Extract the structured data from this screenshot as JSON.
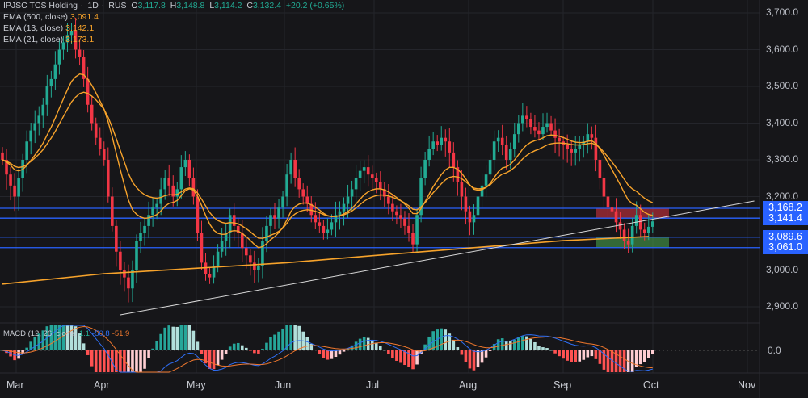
{
  "header": {
    "symbol": "IPJSC TCS Holding",
    "interval": "1D",
    "exchange": "RUS",
    "sep": "·",
    "o_label": "O",
    "o": "3,117.8",
    "h_label": "H",
    "h": "3,148.8",
    "l_label": "L",
    "l": "3,114.2",
    "c_label": "C",
    "c": "3,132.4",
    "change": "+20.2 (+0.65%)"
  },
  "indicators": [
    {
      "label": "EMA (500, close)",
      "value": "3,091.4"
    },
    {
      "label": "EMA (13, close)",
      "value": "3,142.1"
    },
    {
      "label": "EMA (21, close)",
      "value": "3,173.1"
    }
  ],
  "macd": {
    "label": "MACD (12, 26, close)",
    "hist": "1.1",
    "macd": "-50.8",
    "signal": "-51.9",
    "zero_label": "0.0"
  },
  "colors": {
    "up": "#22ab94",
    "down": "#f23645",
    "ema13": "#f7a32b",
    "ema21": "#f7a32b",
    "ema500": "#f7a32b",
    "level": "#2962ff",
    "macd": "#2f6ff5",
    "signal": "#f0782e"
  },
  "chart_data": {
    "type": "candlestick",
    "ylim": [
      2850,
      3720
    ],
    "yticks": [
      "3,700.0",
      "3,600.0",
      "3,500.0",
      "3,400.0",
      "3,300.0",
      "3,200.0",
      "3,000.0",
      "2,900.0"
    ],
    "ytick_values": [
      3700,
      3600,
      3500,
      3400,
      3300,
      3200,
      3000,
      2900
    ],
    "months": [
      "Mar",
      "Apr",
      "May",
      "Jun",
      "Jul",
      "Aug",
      "Sep",
      "Oct",
      "Nov"
    ],
    "closes": [
      3300,
      3260,
      3230,
      3200,
      3250,
      3300,
      3350,
      3380,
      3400,
      3420,
      3450,
      3500,
      3520,
      3560,
      3600,
      3620,
      3640,
      3650,
      3600,
      3580,
      3520,
      3450,
      3400,
      3360,
      3330,
      3300,
      3200,
      3120,
      3050,
      3000,
      2980,
      2950,
      3000,
      3080,
      3100,
      3120,
      3150,
      3170,
      3180,
      3220,
      3250,
      3230,
      3200,
      3220,
      3280,
      3300,
      3250,
      3200,
      3100,
      3020,
      2990,
      2980,
      3010,
      3050,
      3080,
      3100,
      3150,
      3120,
      3100,
      3060,
      3040,
      3020,
      3000,
      3010,
      3080,
      3120,
      3150,
      3140,
      3170,
      3200,
      3260,
      3300,
      3250,
      3220,
      3200,
      3180,
      3150,
      3130,
      3120,
      3100,
      3110,
      3130,
      3150,
      3160,
      3180,
      3200,
      3220,
      3250,
      3270,
      3280,
      3260,
      3250,
      3240,
      3220,
      3200,
      3180,
      3160,
      3150,
      3140,
      3120,
      3100,
      3070,
      3150,
      3250,
      3300,
      3330,
      3350,
      3340,
      3360,
      3350,
      3320,
      3280,
      3240,
      3200,
      3160,
      3130,
      3150,
      3200,
      3230,
      3260,
      3300,
      3350,
      3360,
      3340,
      3300,
      3330,
      3370,
      3400,
      3420,
      3410,
      3390,
      3380,
      3370,
      3390,
      3400,
      3380,
      3360,
      3350,
      3340,
      3330,
      3320,
      3330,
      3340,
      3350,
      3370,
      3360,
      3300,
      3250,
      3200,
      3170,
      3160,
      3130,
      3110,
      3080,
      3070,
      3120,
      3150,
      3110,
      3100,
      3117.8,
      3132.4
    ],
    "ema500_points": [
      [
        0,
        2962
      ],
      [
        25,
        2990
      ],
      [
        48,
        3005
      ],
      [
        70,
        3020
      ],
      [
        92,
        3040
      ],
      [
        115,
        3060
      ],
      [
        138,
        3080
      ],
      [
        159,
        3091.4
      ]
    ],
    "trendline": [
      [
        29,
        2878
      ],
      [
        185,
        3188
      ]
    ],
    "levels": [
      {
        "value": 3168.2,
        "label": "3,168.2"
      },
      {
        "value": 3141.4,
        "label": "3,141.4"
      },
      {
        "value": 3089.6,
        "label": "3,089.6"
      },
      {
        "value": 3061.0,
        "label": "3,061.0"
      }
    ],
    "zones": [
      {
        "type": "resistance",
        "from": 3141.4,
        "to": 3168.2
      },
      {
        "type": "support",
        "from": 3061.0,
        "to": 3089.6
      }
    ]
  }
}
